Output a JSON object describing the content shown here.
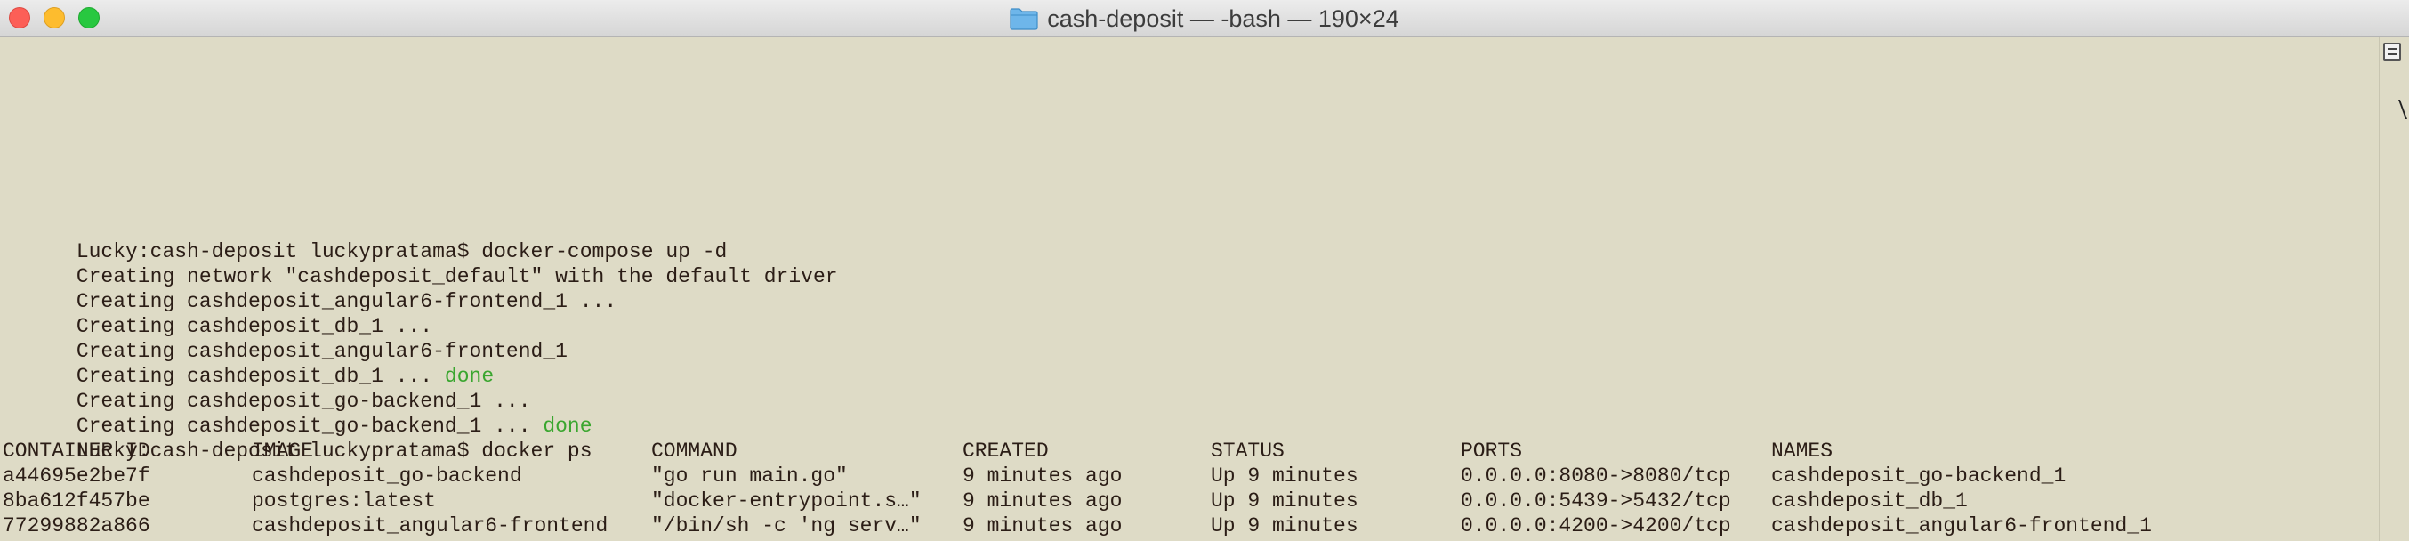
{
  "window": {
    "title": "cash-deposit — -bash — 190×24",
    "folder_icon": "folder-icon"
  },
  "colors": {
    "background": "#dedbc6",
    "text": "#2b1d16",
    "done": "#3aa62f"
  },
  "terminal": {
    "lines": [
      {
        "text": "Lucky:cash-deposit luckypratama$ docker-compose up -d",
        "suffix": ""
      },
      {
        "text": "Creating network \"cashdeposit_default\" with the default driver",
        "suffix": ""
      },
      {
        "text": "Creating cashdeposit_angular6-frontend_1 ...",
        "suffix": ""
      },
      {
        "text": "Creating cashdeposit_db_1 ...",
        "suffix": ""
      },
      {
        "text": "Creating cashdeposit_angular6-frontend_1",
        "suffix": ""
      },
      {
        "text": "Creating cashdeposit_db_1 ... ",
        "suffix": "done"
      },
      {
        "text": "Creating cashdeposit_go-backend_1 ...",
        "suffix": ""
      },
      {
        "text": "Creating cashdeposit_go-backend_1 ... ",
        "suffix": "done"
      },
      {
        "text": "Lucky:cash-deposit luckypratama$ docker ps",
        "suffix": ""
      }
    ],
    "table": {
      "headers": [
        "CONTAINER ID",
        "IMAGE",
        "COMMAND",
        "CREATED",
        "STATUS",
        "PORTS",
        "NAMES"
      ],
      "rows": [
        [
          "a44695e2be7f",
          "cashdeposit_go-backend",
          "\"go run main.go\"",
          "9 minutes ago",
          "Up 9 minutes",
          "0.0.0.0:8080->8080/tcp",
          "cashdeposit_go-backend_1"
        ],
        [
          "8ba612f457be",
          "postgres:latest",
          "\"docker-entrypoint.s…\"",
          "9 minutes ago",
          "Up 9 minutes",
          "0.0.0.0:5439->5432/tcp",
          "cashdeposit_db_1"
        ],
        [
          "77299882a866",
          "cashdeposit_angular6-frontend",
          "\"/bin/sh -c 'ng serv…\"",
          "9 minutes ago",
          "Up 9 minutes",
          "0.0.0.0:4200->4200/tcp",
          "cashdeposit_angular6-frontend_1"
        ]
      ]
    }
  }
}
